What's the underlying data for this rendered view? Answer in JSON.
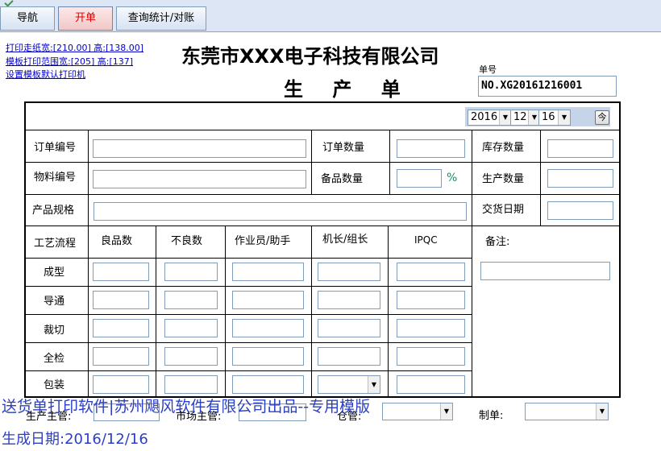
{
  "tabs": [
    {
      "label": "导航"
    },
    {
      "label": "开单"
    },
    {
      "label": "查询统计/对账"
    }
  ],
  "links": {
    "paper_size": "打印走纸宽:[210.00] 高:[138.00]",
    "template_range": "模板打印范围宽:[205] 高:[137]",
    "default_printer": "设置模板默认打印机"
  },
  "header": {
    "company": "东莞市XXX电子科技有限公司",
    "doc_title": "生 产 单",
    "order_no_label": "单号",
    "order_no": "NO.XG20161216001"
  },
  "date": {
    "year": "2016",
    "month": "12",
    "day": "16",
    "today_label": "今"
  },
  "fields": {
    "order_code": "订单编号",
    "order_qty": "订单数量",
    "stock_qty": "库存数量",
    "material_code": "物料编号",
    "spare_qty": "备品数量",
    "percent": "%",
    "production_qty": "生产数量",
    "product_spec": "产品规格",
    "delivery_date": "交货日期"
  },
  "process_table": {
    "headers": [
      "工艺流程",
      "良品数",
      "不良数",
      "作业员/助手",
      "机长/组长",
      "IPQC"
    ],
    "remark_label": "备注:",
    "rows": [
      "成型",
      "导通",
      "裁切",
      "全检",
      "包装"
    ]
  },
  "footer": {
    "production_manager": "生产主管:",
    "market_manager": "市场主管:",
    "warehouse": "仓管:",
    "made_by": "制单:",
    "watermark": "送货单打印软件|苏州飓风软件有限公司出品--专用模版",
    "generated": "生成日期:2016/12/16"
  }
}
